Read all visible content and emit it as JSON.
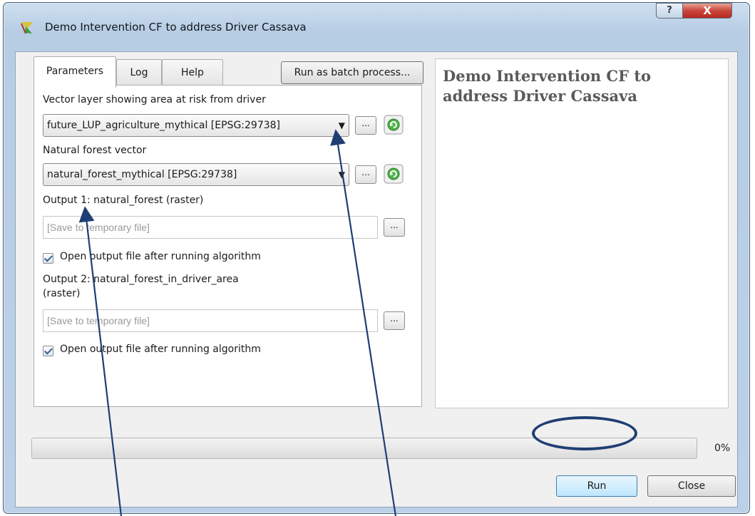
{
  "window": {
    "title": "Demo Intervention CF to address Driver Cassava",
    "help_symbol": "?",
    "close_symbol": "X"
  },
  "tabs": [
    {
      "label": "Parameters"
    },
    {
      "label": "Log"
    },
    {
      "label": "Help"
    }
  ],
  "batch_button": "Run as batch process...",
  "params": {
    "vector_layer_label": "Vector layer showing area at risk from driver",
    "vector_layer_value": "future_LUP_agriculture_mythical [EPSG:29738]",
    "forest_vector_label": "Natural forest vector",
    "forest_vector_value": "natural_forest_mythical [EPSG:29738]",
    "output1_label": "Output 1: natural_forest (raster)",
    "output1_placeholder": "[Save to temporary file]",
    "open_output1": "Open output file after running algorithm",
    "output2_label_line1": "Output 2: natural_forest_in_driver_area",
    "output2_label_line2": "(raster)",
    "output2_placeholder": "[Save to temporary file]",
    "open_output2": "Open output file after running algorithm",
    "ellipsis": "..."
  },
  "help_panel": {
    "title": "Demo Intervention CF to address Driver Cassava"
  },
  "progress": {
    "value": 0,
    "text": "0%"
  },
  "buttons": {
    "run": "Run",
    "close": "Close"
  },
  "colors": {
    "annotation": "#1f3e73",
    "progress_fill": "#37b44a"
  },
  "icons": {
    "app": "qgis-icon",
    "refresh": "green-refresh-icon",
    "dropdown": "down-triangle"
  }
}
